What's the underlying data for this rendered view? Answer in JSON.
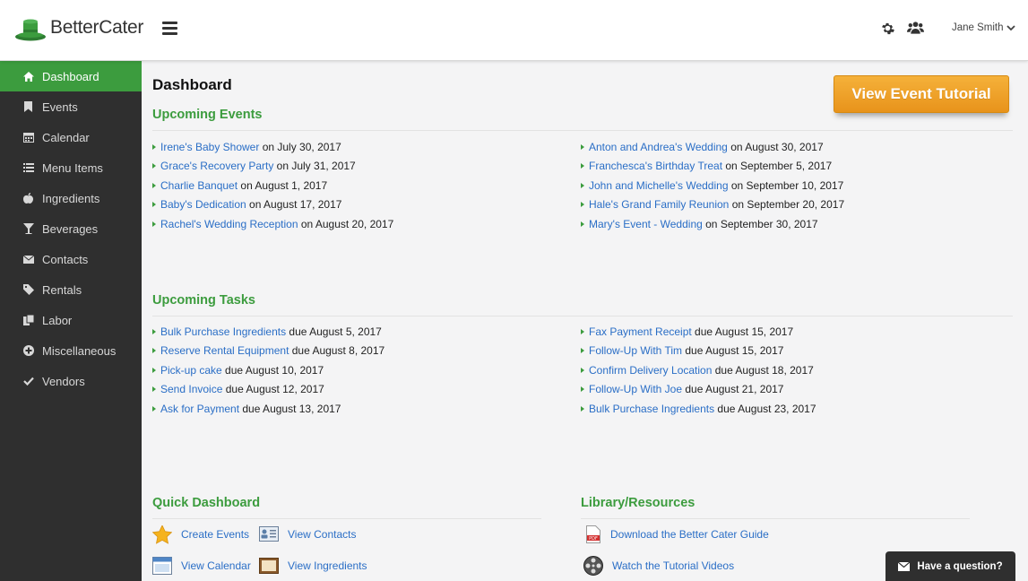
{
  "brand": {
    "name": "BetterCater",
    "accent": "#3c9c3e",
    "link": "#2a6ec6",
    "button_orange": "#ee9f25"
  },
  "header": {
    "menu_icon": "hamburger-icon",
    "settings_icon": "gear-icon",
    "team_icon": "users-icon",
    "user_name": "Jane Smith"
  },
  "sidebar": {
    "items": [
      {
        "label": "Dashboard",
        "icon": "home-icon",
        "active": true
      },
      {
        "label": "Events",
        "icon": "bookmark-icon"
      },
      {
        "label": "Calendar",
        "icon": "calendar-icon"
      },
      {
        "label": "Menu Items",
        "icon": "list-icon"
      },
      {
        "label": "Ingredients",
        "icon": "apple-icon"
      },
      {
        "label": "Beverages",
        "icon": "cocktail-icon"
      },
      {
        "label": "Contacts",
        "icon": "envelope-icon"
      },
      {
        "label": "Rentals",
        "icon": "tag-icon"
      },
      {
        "label": "Labor",
        "icon": "copy-icon"
      },
      {
        "label": "Miscellaneous",
        "icon": "plus-circle-icon"
      },
      {
        "label": "Vendors",
        "icon": "check-icon"
      }
    ]
  },
  "main": {
    "title": "Dashboard",
    "tutorial_button": "View Event Tutorial",
    "upcoming_events": {
      "title": "Upcoming Events",
      "left": [
        {
          "link": "Irene's Baby Shower",
          "text": " on July 30, 2017"
        },
        {
          "link": "Grace's Recovery Party",
          "text": " on July 31, 2017"
        },
        {
          "link": "Charlie Banquet",
          "text": " on August 1, 2017"
        },
        {
          "link": "Baby's Dedication",
          "text": " on August 17, 2017"
        },
        {
          "link": "Rachel's Wedding Reception",
          "text": " on August 20, 2017"
        }
      ],
      "right": [
        {
          "link": "Anton and Andrea's Wedding",
          "text": " on August 30, 2017"
        },
        {
          "link": "Franchesca's Birthday Treat",
          "text": " on September 5, 2017"
        },
        {
          "link": "John and Michelle's Wedding",
          "text": " on September 10, 2017"
        },
        {
          "link": "Hale's Grand Family Reunion",
          "text": " on September 20, 2017"
        },
        {
          "link": "Mary's Event - Wedding",
          "text": " on September 30, 2017"
        }
      ]
    },
    "upcoming_tasks": {
      "title": "Upcoming Tasks",
      "left": [
        {
          "link": "Bulk Purchase Ingredients",
          "text": " due August 5, 2017"
        },
        {
          "link": "Reserve Rental Equipment",
          "text": " due August 8, 2017"
        },
        {
          "link": "Pick-up cake",
          "text": " due August 10, 2017"
        },
        {
          "link": "Send Invoice",
          "text": " due August 12, 2017"
        },
        {
          "link": "Ask for Payment",
          "text": " due August 13, 2017"
        }
      ],
      "right": [
        {
          "link": "Fax Payment Receipt",
          "text": " due August 15, 2017"
        },
        {
          "link": "Follow-Up With Tim",
          "text": " due August 15, 2017"
        },
        {
          "link": "Confirm Delivery Location",
          "text": " due August 18, 2017"
        },
        {
          "link": "Follow-Up With Joe",
          "text": " due August 21, 2017"
        },
        {
          "link": "Bulk Purchase Ingredients",
          "text": " due August 23, 2017"
        }
      ]
    },
    "quick_dashboard": {
      "title": "Quick Dashboard",
      "create_events": "Create Events",
      "view_contacts": "View Contacts",
      "view_calendar": "View Calendar",
      "view_ingredients": "View Ingredients"
    },
    "library": {
      "title": "Library/Resources",
      "guide": "Download the Better Cater Guide",
      "videos": "Watch the Tutorial Videos"
    }
  },
  "chat": {
    "label": "Have a question?",
    "icon": "envelope-icon"
  }
}
